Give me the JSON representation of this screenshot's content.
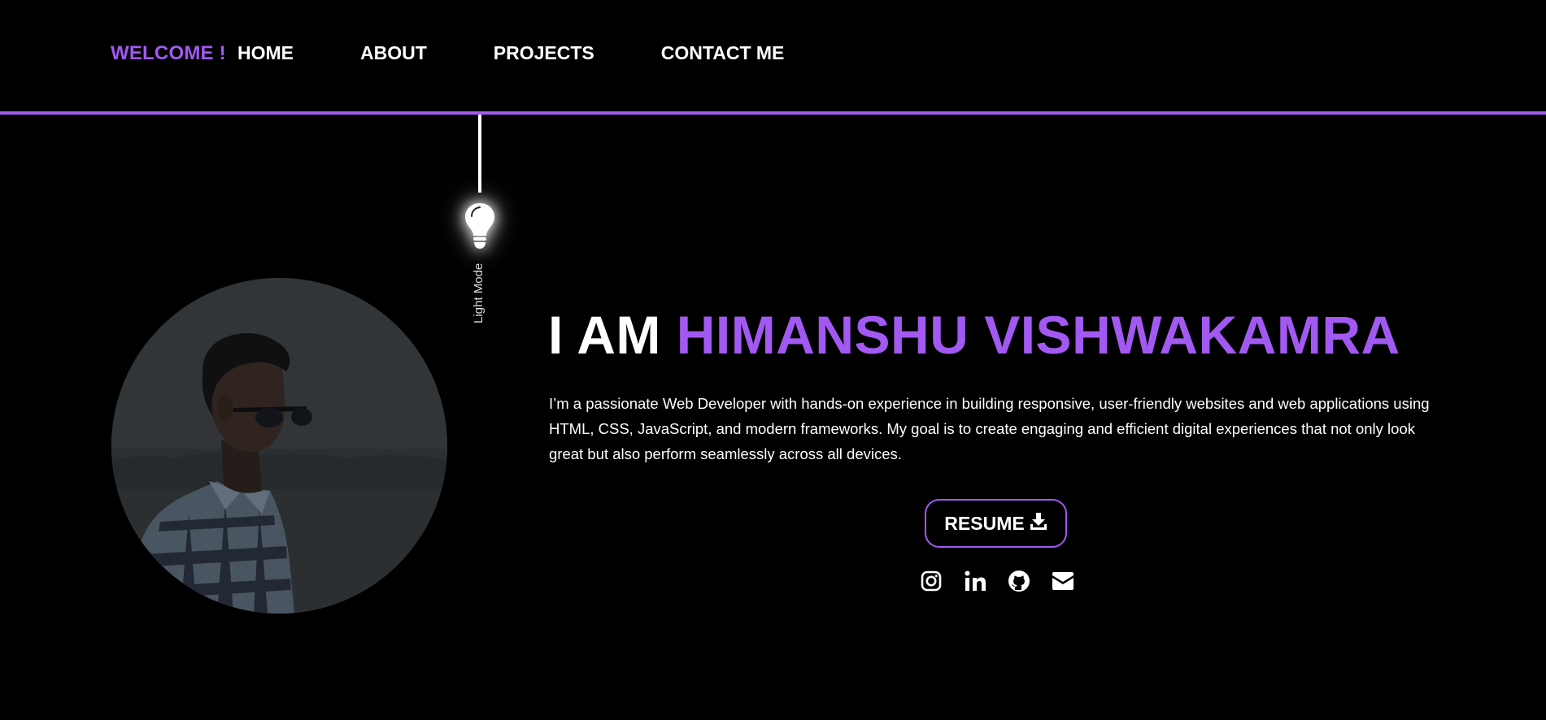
{
  "nav": {
    "brand": "WELCOME !",
    "links": [
      {
        "label": "HOME"
      },
      {
        "label": "ABOUT"
      },
      {
        "label": "PROJECTS"
      },
      {
        "label": "CONTACT ME"
      }
    ]
  },
  "theme_toggle": {
    "label": "Light Mode",
    "icon": "lightbulb-icon"
  },
  "hero": {
    "title_prefix": "I AM ",
    "title_name": "HIMANSHU VISHWAKAMRA",
    "description": "I’m a passionate Web Developer with hands-on experience in building responsive, user-friendly websites and web applications using HTML, CSS, JavaScript, and modern frameworks. My goal is to create engaging and efficient digital experiences that not only look great but also perform seamlessly across all devices.",
    "resume_label": "RESUME",
    "resume_icon": "download-icon",
    "socials": [
      {
        "icon": "instagram-icon"
      },
      {
        "icon": "linkedin-icon"
      },
      {
        "icon": "github-icon"
      },
      {
        "icon": "envelope-icon"
      }
    ]
  },
  "colors": {
    "accent": "#a259f2",
    "background": "#000000",
    "text": "#ffffff"
  }
}
